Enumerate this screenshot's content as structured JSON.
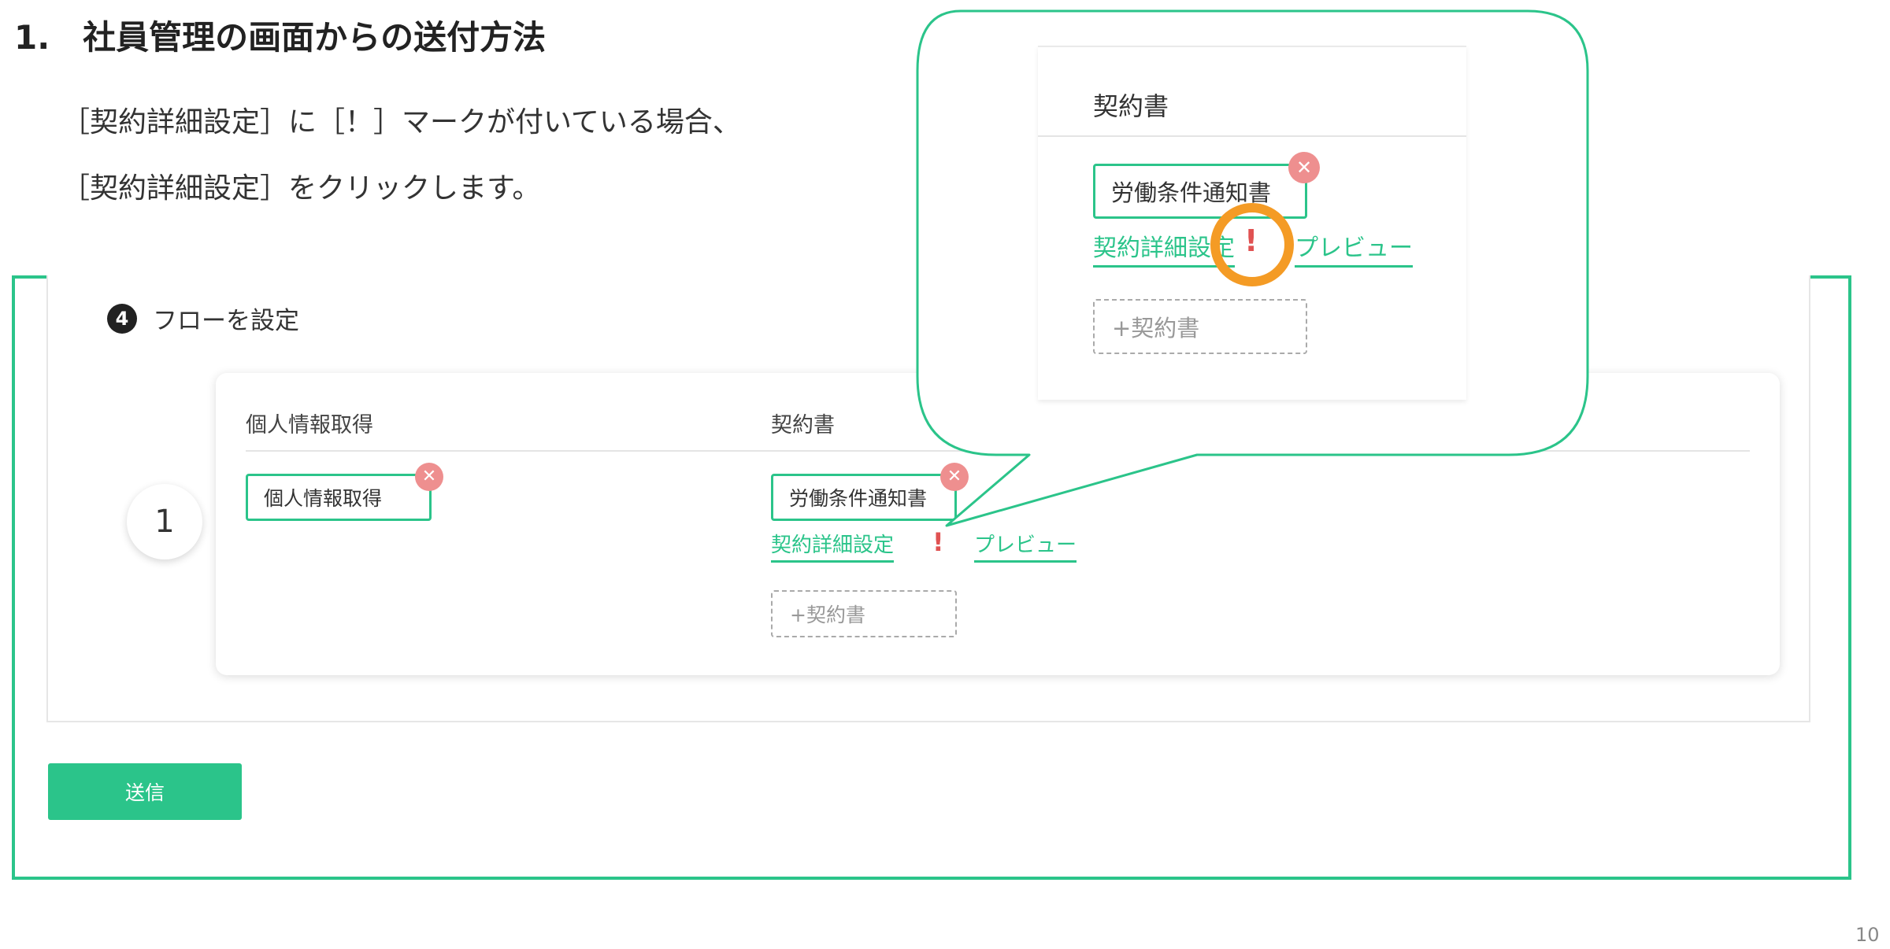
{
  "slide": {
    "title": "1.　社員管理の画面からの送付方法",
    "instruction_line1": "［契約詳細設定］に［！］マークが付いている場合、",
    "instruction_line2": "［契約詳細設定］をクリックします。",
    "page_number": "10"
  },
  "flow": {
    "step_number": "4",
    "step_label": "フローを設定",
    "row_number": "1",
    "columns": {
      "personal_info_header": "個人情報取得",
      "contract_header": "契約書"
    },
    "personal_info_item": "個人情報取得",
    "contract_item": "労働条件通知書",
    "contract_detail_link": "契約詳細設定",
    "warning_mark": "!",
    "preview_link": "プレビュー",
    "add_contract_label": "+契約書",
    "remove_glyph": "✕"
  },
  "zoom": {
    "contract_header": "契約書",
    "contract_item": "労働条件通知書",
    "contract_detail_link": "契約詳細設定",
    "warning_mark": "!",
    "preview_link": "プレビュー",
    "add_contract_label": "+契約書",
    "remove_glyph": "✕"
  },
  "actions": {
    "send_label": "送信"
  },
  "colors": {
    "accent": "#2bc48a",
    "warning": "#e05252",
    "remove": "#ee8f8f",
    "highlight": "#f49b25"
  }
}
